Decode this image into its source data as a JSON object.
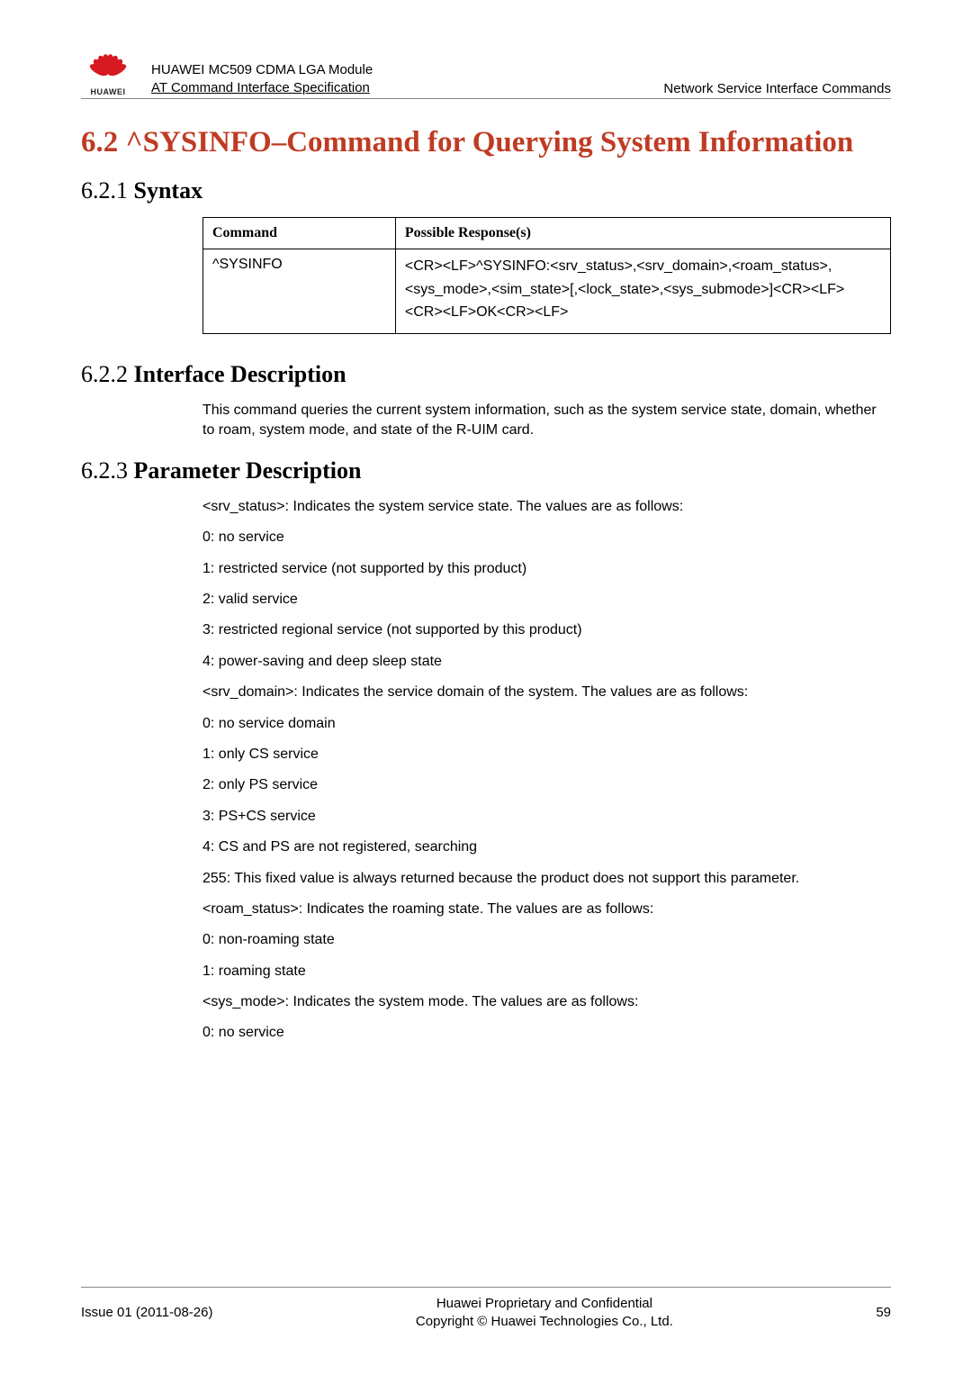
{
  "header": {
    "logo_text": "HUAWEI",
    "doc_line1": "HUAWEI MC509 CDMA LGA Module",
    "doc_line2": "AT Command Interface Specification",
    "right": "Network Service Interface Commands"
  },
  "section": {
    "title": "6.2 ^SYSINFO–Command for Querying System Information"
  },
  "s621": {
    "heading_num": "6.2.1 ",
    "heading_label": "Syntax",
    "th_command": "Command",
    "th_response": "Possible Response(s)",
    "cmd": "^SYSINFO",
    "resp1": "<CR><LF>^SYSINFO:<srv_status>,<srv_domain>,<roam_status>,",
    "resp2": "<sys_mode>,<sim_state>[,<lock_state>,<sys_submode>]<CR><LF>",
    "resp3": "<CR><LF>OK<CR><LF>"
  },
  "s622": {
    "heading_num": "6.2.2 ",
    "heading_label": "Interface Description",
    "p1": "This command queries the current system information, such as the system service state, domain, whether to roam, system mode, and state of the R-UIM card."
  },
  "s623": {
    "heading_num": "6.2.3 ",
    "heading_label": "Parameter Description",
    "p": [
      "<srv_status>: Indicates the system service state. The values are as follows:",
      "0: no service",
      "1: restricted service (not supported by this product)",
      "2: valid service",
      "3: restricted regional service (not supported by this product)",
      "4: power-saving and deep sleep state",
      "<srv_domain>: Indicates the service domain of the system. The values are as follows:",
      "0: no service domain",
      "1: only CS service",
      "2: only PS service",
      "3: PS+CS service",
      "4: CS and PS are not registered, searching",
      "255: This fixed value is always returned because the product does not support this parameter.",
      "<roam_status>: Indicates the roaming state. The values are as follows:",
      "0: non-roaming state",
      "1: roaming state",
      "<sys_mode>: Indicates the system mode. The values are as follows:",
      "0: no service"
    ]
  },
  "footer": {
    "left": "Issue 01 (2011-08-26)",
    "center1": "Huawei Proprietary and Confidential",
    "center2": "Copyright © Huawei Technologies Co., Ltd.",
    "right": "59"
  }
}
